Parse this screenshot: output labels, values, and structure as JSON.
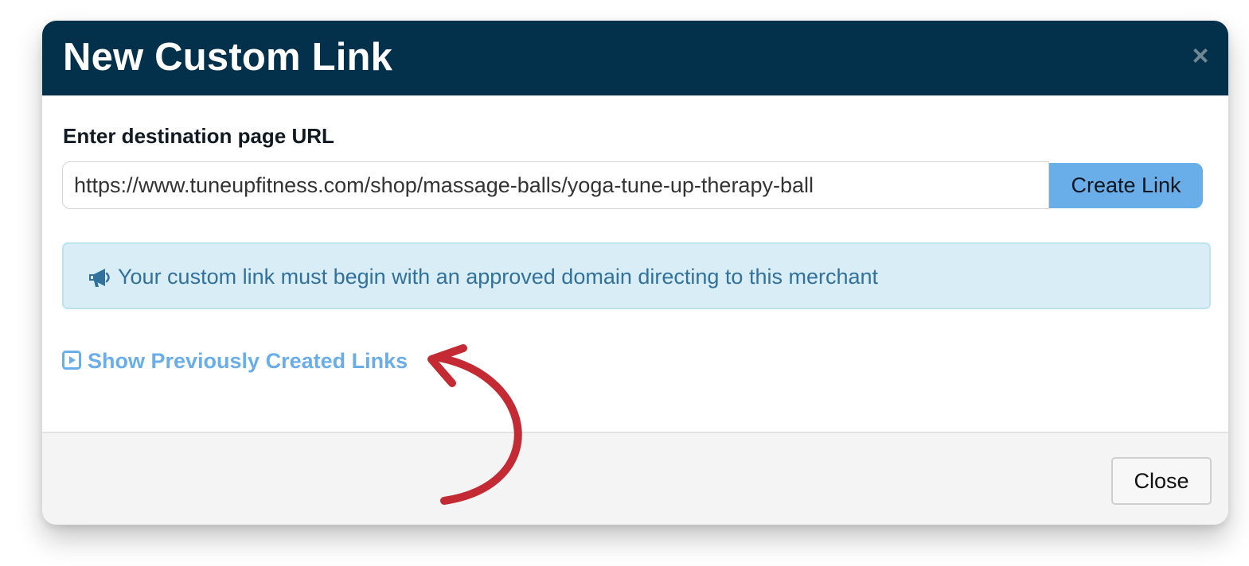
{
  "dialog": {
    "title": "New Custom Link",
    "close_symbol": "×",
    "close_icon": "close-x-icon"
  },
  "form": {
    "label": "Enter destination page URL",
    "url_value": "https://www.tuneupfitness.com/shop/massage-balls/yoga-tune-up-therapy-ball",
    "create_button": "Create Link"
  },
  "notice": {
    "icon": "megaphone-icon",
    "text": "Your custom link must begin with an approved domain directing to this merchant"
  },
  "previous_links": {
    "icon": "play-square-icon",
    "label": "Show Previously Created Links"
  },
  "footer": {
    "close_button": "Close"
  },
  "annotation": {
    "type": "curved-arrow",
    "color": "#c32a34"
  },
  "colors": {
    "header_bg": "#03304a",
    "primary_button": "#6aaee9",
    "info_bg": "#d9edf7",
    "info_text": "#31719b",
    "link": "#6aaee9"
  }
}
